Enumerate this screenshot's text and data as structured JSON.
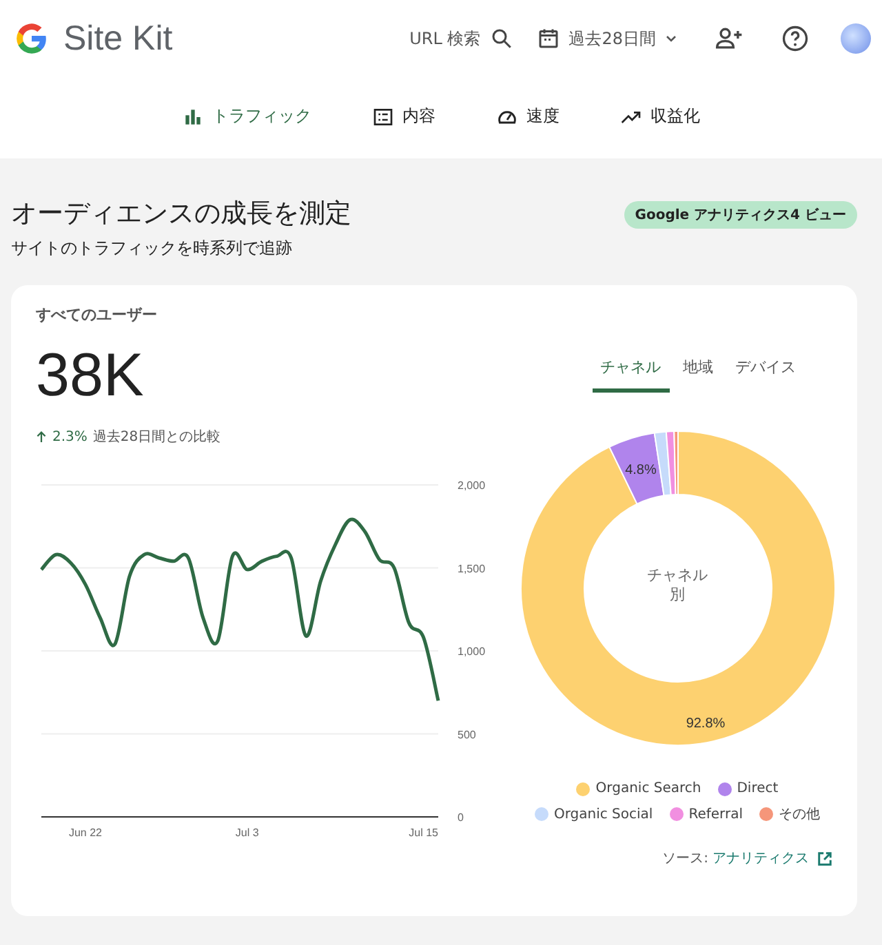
{
  "header": {
    "brand": "Site Kit",
    "url_search": "URL 検索",
    "date_range": "過去28日間"
  },
  "nav_tabs": [
    {
      "label": "トラフィック",
      "selected": true
    },
    {
      "label": "内容",
      "selected": false
    },
    {
      "label": "速度",
      "selected": false
    },
    {
      "label": "収益化",
      "selected": false
    }
  ],
  "section": {
    "title": "オーディエンスの成長を測定",
    "subtitle": "サイトのトラフィックを時系列で追跡",
    "badge": "Google アナリティクス4 ビュー"
  },
  "card": {
    "metric_label": "すべてのユーザー",
    "metric_value": "38K",
    "change": "2.3%",
    "change_note": "過去28日間との比較",
    "line_chart": {
      "x_axis_labels": [
        "Jun 22",
        "Jul 3",
        "Jul 15"
      ],
      "chart_data": {
        "type": "line",
        "ylim": [
          0,
          2000
        ],
        "grid": true,
        "yticks": [
          {
            "value": 0,
            "label": "0"
          },
          {
            "value": 500,
            "label": "500"
          },
          {
            "value": 1000,
            "label": "1,000"
          },
          {
            "value": 1500,
            "label": "1,500"
          },
          {
            "value": 2000,
            "label": "2,000"
          }
        ],
        "series": [
          {
            "color": "#2f6b45",
            "values": [
              1490,
              1580,
              1530,
              1400,
              1200,
              1040,
              1450,
              1580,
              1560,
              1540,
              1560,
              1200,
              1060,
              1570,
              1490,
              1540,
              1570,
              1560,
              1090,
              1420,
              1640,
              1790,
              1720,
              1550,
              1500,
              1170,
              1080,
              700
            ]
          }
        ]
      }
    },
    "dimension_tabs": [
      {
        "label": "チャネル",
        "selected": true
      },
      {
        "label": "地域",
        "selected": false
      },
      {
        "label": "デバイス",
        "selected": false
      }
    ],
    "donut": {
      "center_label": "チャネル別",
      "chart_data": {
        "type": "donut",
        "categories": [
          "Organic Search",
          "Direct",
          "Organic Social",
          "Referral",
          "その他"
        ],
        "series": [
          {
            "values": [
              92.8,
              4.8,
              1.2,
              0.8,
              0.4
            ]
          }
        ],
        "colors": [
          "#fdd170",
          "#b084ec",
          "#c6dbfb",
          "#f18fe0",
          "#f5967a"
        ],
        "value_labels": [
          "92.8%",
          "4.8%",
          null,
          null,
          null
        ]
      }
    },
    "source_label": "ソース:",
    "source_link": "アナリティクス"
  }
}
